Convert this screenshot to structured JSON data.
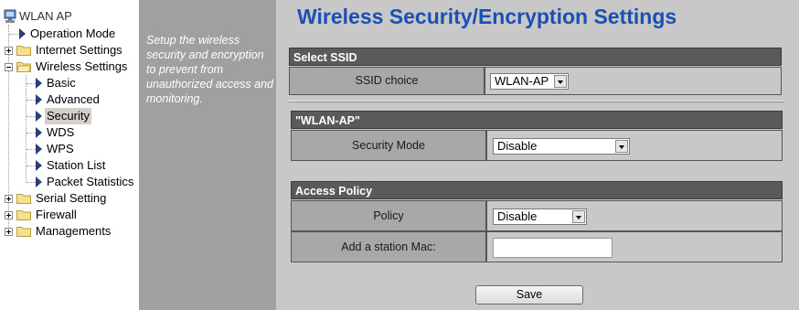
{
  "tree": {
    "root": "WLAN AP",
    "items": [
      {
        "label": "Operation Mode"
      },
      {
        "label": "Internet Settings"
      },
      {
        "label": "Wireless Settings"
      },
      {
        "label": "Basic"
      },
      {
        "label": "Advanced"
      },
      {
        "label": "Security"
      },
      {
        "label": "WDS"
      },
      {
        "label": "WPS"
      },
      {
        "label": "Station List"
      },
      {
        "label": "Packet Statistics"
      },
      {
        "label": "Serial Setting"
      },
      {
        "label": "Firewall"
      },
      {
        "label": "Managements"
      }
    ]
  },
  "description": "Setup the wireless security and encryption to prevent from unauthorized access and monitoring.",
  "page_title": "Wireless Security/Encryption Settings",
  "ssid_section": {
    "header": "Select SSID",
    "label": "SSID choice",
    "value": "WLAN-AP"
  },
  "security_section": {
    "header": "\"WLAN-AP\"",
    "label": "Security Mode",
    "value": "Disable"
  },
  "access_section": {
    "header": "Access Policy",
    "policy_label": "Policy",
    "policy_value": "Disable",
    "mac_label": "Add a station Mac:",
    "mac_value": ""
  },
  "save_label": "Save",
  "colors": {
    "title": "#1a4fb5",
    "section_header": "#5a5a5a",
    "tree_arrow": "#2c3e7a"
  }
}
